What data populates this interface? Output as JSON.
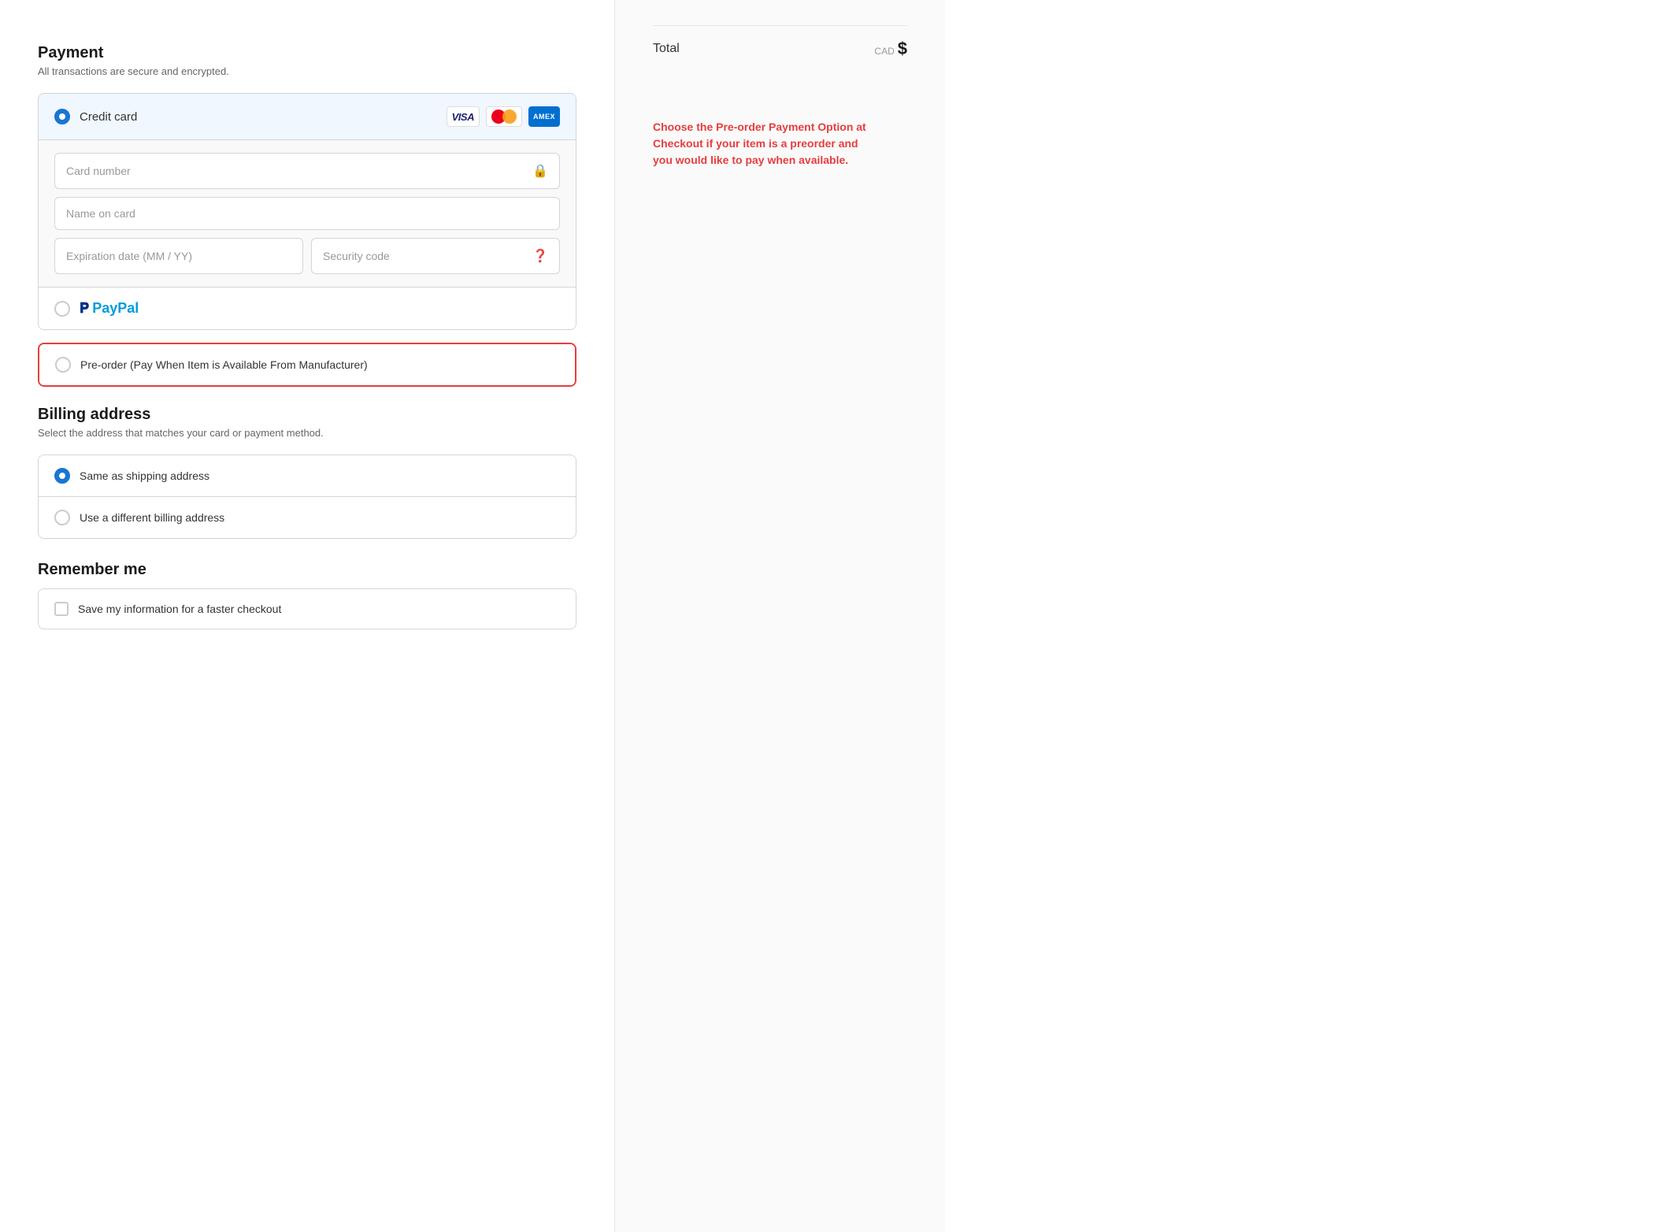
{
  "payment": {
    "title": "Payment",
    "subtitle": "All transactions are secure and encrypted.",
    "options": {
      "credit_card": {
        "label": "Credit card",
        "selected": true,
        "card_types": [
          "VISA",
          "MC",
          "AMEX"
        ]
      },
      "paypal": {
        "label": "PayPal"
      },
      "preorder": {
        "label": "Pre-order (Pay When Item is Available From Manufacturer)"
      }
    },
    "fields": {
      "card_number": {
        "placeholder": "Card number"
      },
      "name_on_card": {
        "placeholder": "Name on card"
      },
      "expiration_date": {
        "placeholder": "Expiration date (MM / YY)"
      },
      "security_code": {
        "placeholder": "Security code"
      }
    }
  },
  "billing_address": {
    "title": "Billing address",
    "subtitle": "Select the address that matches your card or payment method.",
    "options": {
      "same_as_shipping": {
        "label": "Same as shipping address",
        "selected": true
      },
      "different": {
        "label": "Use a different billing address"
      }
    }
  },
  "remember_me": {
    "title": "Remember me",
    "option": {
      "label": "Save my information for a faster checkout"
    }
  },
  "sidebar": {
    "total_label": "Total",
    "currency": "CAD",
    "price": "$"
  },
  "preorder_message": "Choose the Pre-order Payment Option at Checkout if your item is a preorder and you would like to pay when available."
}
